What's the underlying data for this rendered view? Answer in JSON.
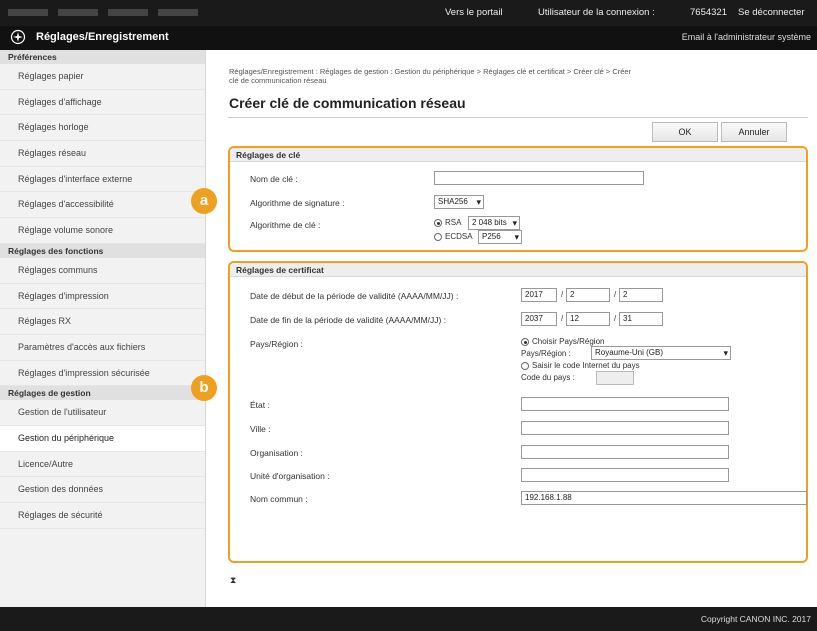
{
  "topbar": {
    "portal_link": "Vers le portail",
    "user_label": "Utilisateur de la connexion :",
    "user_id": "7654321",
    "logout": "Se déconnecter"
  },
  "header": {
    "title": "Réglages/Enregistrement",
    "email_admin": "Email à l'administrateur système"
  },
  "sidebar": {
    "sections": [
      {
        "title": "Préférences",
        "items": [
          "Réglages papier",
          "Réglages d'affichage",
          "Réglages horloge",
          "Réglages réseau",
          "Réglages d'interface externe",
          "Réglages d'accessibilité",
          "Réglage volume sonore"
        ]
      },
      {
        "title": "Réglages des fonctions",
        "items": [
          "Réglages communs",
          "Réglages d'impression",
          "Réglages RX",
          "Paramètres d'accès aux fichiers",
          "Réglages d'impression sécurisée"
        ]
      },
      {
        "title": "Réglages de gestion",
        "items": [
          "Gestion de l'utilisateur",
          "Gestion du périphérique",
          "Licence/Autre",
          "Gestion des données",
          "Réglages de sécurité"
        ]
      }
    ],
    "active_item": "Gestion du périphérique"
  },
  "main": {
    "breadcrumb_line1": "Réglages/Enregistrement : Réglages de gestion : Gestion du périphérique > Réglages clé et certificat > Créer clé > Créer",
    "breadcrumb_line2": "clé de communication réseau",
    "page_title": "Créer clé de communication réseau",
    "ok_label": "OK",
    "cancel_label": "Annuler",
    "key_settings": {
      "header": "Réglages de clé",
      "key_name_label": "Nom de clé :",
      "key_name_value": "",
      "signature_label": "Algorithme de signature :",
      "signature_value": "SHA256",
      "key_algo_label": "Algorithme de clé :",
      "rsa_label": "RSA",
      "rsa_bits": "2 048 bits",
      "ecdsa_label": "ECDSA",
      "ecdsa_value": "P256",
      "selected_algo": "RSA"
    },
    "cert_settings": {
      "header": "Réglages de certificat",
      "start_label": "Date de début de la période de validité (AAAA/MM/JJ) :",
      "start_year": "2017",
      "start_month": "2",
      "start_day": "2",
      "end_label": "Date de fin de la période de validité (AAAA/MM/JJ) :",
      "end_year": "2037",
      "end_month": "12",
      "end_day": "31",
      "date_sep": "/",
      "country_label": "Pays/Région :",
      "choose_country": "Choisir Pays/Région",
      "country_field_label": "Pays/Région :",
      "country_value": "Royaume-Uni (GB)",
      "enter_code": "Saisir le code Internet du pays",
      "country_code_label": "Code du pays :",
      "country_code_value": "",
      "state_label": "État :",
      "state_value": "",
      "city_label": "Ville :",
      "city_value": "",
      "org_label": "Organisation :",
      "org_value": "",
      "org_unit_label": "Unité d'organisation :",
      "org_unit_value": "",
      "common_name_label": "Nom commun :",
      "common_name_value": "192.168.1.88"
    },
    "badges": [
      "a",
      "b"
    ],
    "pager_icon": "⧗"
  },
  "footer": {
    "copyright": "Copyright CANON INC. 2017"
  }
}
